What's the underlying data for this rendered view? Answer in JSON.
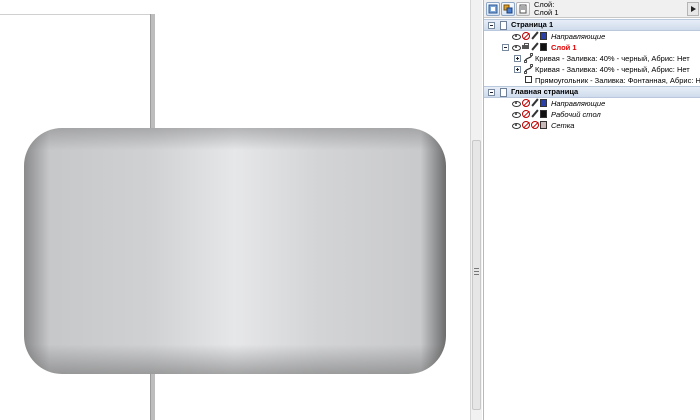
{
  "docker": {
    "layer_caption_line1": "Слой:",
    "layer_caption_line2": "Слой 1"
  },
  "tree": {
    "page1": {
      "label": "Страница 1",
      "guides_layer": {
        "label": "Направляющие",
        "color": "#2b3fa8"
      },
      "layer1": {
        "label": "Слой 1",
        "color": "#111111",
        "objects": [
          {
            "label": "Кривая - Заливка: 40% - черный, Абрис: Нет",
            "type": "curve"
          },
          {
            "label": "Кривая - Заливка: 40% - черный, Абрис: Нет",
            "type": "curve"
          },
          {
            "label": "Прямоугольник - Заливка: Фонтанная, Абрис: Н",
            "type": "rectangle"
          }
        ]
      }
    },
    "master_page": {
      "label": "Главная страница",
      "guides_layer": {
        "label": "Направляющие",
        "color": "#2b3fa8"
      },
      "desktop_layer": {
        "label": "Рабочий стол",
        "color": "#111111"
      },
      "grid_layer": {
        "label": "Сетка",
        "color": "#c9b9b9"
      }
    }
  },
  "colors": {
    "selected_layer_text": "#e00000",
    "page_row_bg": "#cfdbec"
  }
}
